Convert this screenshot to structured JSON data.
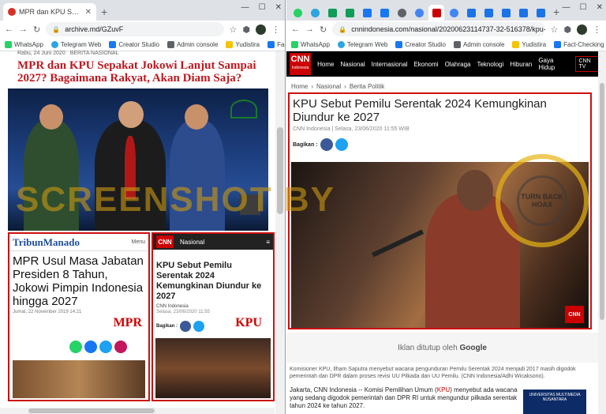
{
  "left_window": {
    "tab_title": "MPR dan KPU Sepakat Jokowi La",
    "url": "archive.md/GZuvF",
    "bookmarks": [
      "WhatsApp",
      "Telegram Web",
      "Creator Studio",
      "Admin console",
      "Yudistira",
      "Fact-Checking"
    ],
    "article": {
      "date": "Rabu, 24 Juni 2020",
      "category": "BERITA NASIONAL",
      "headline": "MPR dan KPU Sepakat Jokowi Lanjut Sampai 2027? Bagaimana Rakyat, Akan Diam Saja?",
      "tribun": {
        "logo": "TribunManado",
        "menu": "Menu",
        "title": "MPR Usul Masa Jabatan Presiden 8 Tahun, Jokowi Pimpin Indonesia hingga 2027",
        "date": "Jumat, 22 November 2019 14:21",
        "tag": "MPR"
      },
      "cnn_clip": {
        "logo": "CNN",
        "section": "Nasional",
        "title": "KPU Sebut Pemilu Serentak 2024 Kemungkinan Diundur ke 2027",
        "source": "CNN Indonesia",
        "date": "Selasa, 23/06/2020 11:55",
        "share_label": "Bagikan :",
        "tag": "KPU"
      }
    }
  },
  "watermark": "SCREENSHOT BY",
  "right_window": {
    "url": "cnnindonesia.com/nasional/20200623114737-32-516378/kpu-sebut-pemilu-...",
    "bookmarks": [
      "WhatsApp",
      "Telegram Web",
      "Creator Studio",
      "Admin console",
      "Yudistira",
      "Fact-Checking"
    ],
    "nav": {
      "brand": "CNN",
      "brand_sub": "Indonesia",
      "items": [
        "Home",
        "Nasional",
        "Internasional",
        "Ekonomi",
        "Olahraga",
        "Teknologi",
        "Hiburan",
        "Gaya Hidup"
      ],
      "tv": "CNN TV"
    },
    "breadcrumb": [
      "Home",
      "Nasional",
      "Berita Politik"
    ],
    "article": {
      "title": "KPU Sebut Pemilu Serentak 2024 Kemungkinan Diundur ke 2027",
      "source": "CNN Indonesia | Selasa, 23/06/2020 11:55 WIB",
      "share_label": "Bagikan :",
      "corner_logo": "CNN",
      "stamp": "TURN BACK HOAX",
      "ad_text": "Iklan ditutup oleh",
      "ad_brand": "Google",
      "caption": "Komisioner KPU, Ilham Saputra menyebut wacana pengunduran Pemilu Serentak 2024 menjadi 2017 masih digodok pemerintah dan DPR dalam proses revisi UU Pilkada dan UU Pemilu. (CNN Indonesia/Adhi Wicaksono).",
      "lead_before": "Jakarta, CNN Indonesia -- Komisi Pemilihan Umum (",
      "lead_kpu": "KPU",
      "lead_after": ") menyebut ada wacana yang sedang digodok pemerintah dan DPR RI untuk mengundur pilkada serentak tahun 2024 ke tahun 2027.",
      "side_ad": "UNIVERSITAS MULTIMEDIA NUSANTARA"
    }
  },
  "colors": {
    "headline_red": "#c0181f",
    "cnn_red": "#cc0000",
    "frame_red": "#cc1010",
    "watermark": "#c69614"
  }
}
